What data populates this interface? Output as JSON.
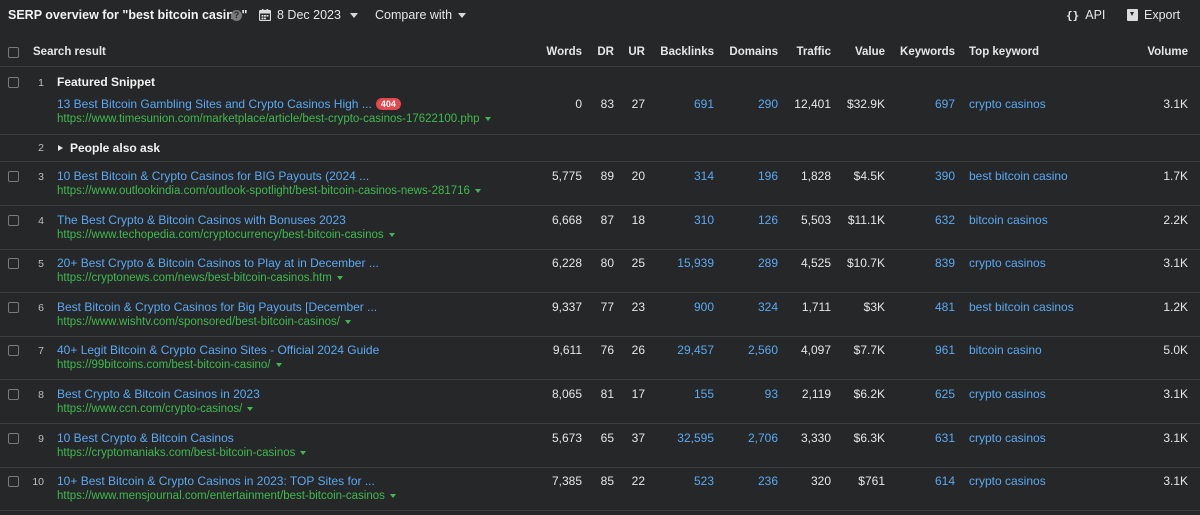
{
  "header": {
    "title": "SERP overview for \"best bitcoin casino\"",
    "help_icon": "?",
    "date": "8 Dec 2023",
    "compare_label": "Compare with",
    "api_icon": "{}",
    "api_label": "API",
    "export_label": "Export"
  },
  "columns": {
    "search_result": "Search result",
    "words": "Words",
    "dr": "DR",
    "ur": "UR",
    "backlinks": "Backlinks",
    "domains": "Domains",
    "traffic": "Traffic",
    "value": "Value",
    "keywords": "Keywords",
    "top_keyword": "Top keyword",
    "volume": "Volume"
  },
  "featured": {
    "pos": "1",
    "label": "Featured Snippet",
    "title": "13 Best Bitcoin Gambling Sites and Crypto Casinos High ...",
    "badge": "404",
    "url": "https://www.timesunion.com/marketplace/article/best-crypto-casinos-17622100.php",
    "words": "0",
    "dr": "83",
    "ur": "27",
    "backlinks": "691",
    "domains": "290",
    "traffic": "12,401",
    "value": "$32.9K",
    "keywords": "697",
    "top_keyword": "crypto casinos",
    "volume": "3.1K"
  },
  "people_also_ask": {
    "pos": "2",
    "label": "People also ask"
  },
  "rows": [
    {
      "pos": "3",
      "title": "10 Best Bitcoin & Crypto Casinos for BIG Payouts (2024 ...",
      "url": "https://www.outlookindia.com/outlook-spotlight/best-bitcoin-casinos-news-281716",
      "words": "5,775",
      "dr": "89",
      "ur": "20",
      "backlinks": "314",
      "domains": "196",
      "traffic": "1,828",
      "value": "$4.5K",
      "keywords": "390",
      "top_keyword": "best bitcoin casino",
      "volume": "1.7K"
    },
    {
      "pos": "4",
      "title": "The Best Crypto & Bitcoin Casinos with Bonuses 2023",
      "url": "https://www.techopedia.com/cryptocurrency/best-bitcoin-casinos",
      "words": "6,668",
      "dr": "87",
      "ur": "18",
      "backlinks": "310",
      "domains": "126",
      "traffic": "5,503",
      "value": "$11.1K",
      "keywords": "632",
      "top_keyword": "bitcoin casinos",
      "volume": "2.2K"
    },
    {
      "pos": "5",
      "title": "20+ Best Crypto & Bitcoin Casinos to Play at in December ...",
      "url": "https://cryptonews.com/news/best-bitcoin-casinos.htm",
      "words": "6,228",
      "dr": "80",
      "ur": "25",
      "backlinks": "15,939",
      "domains": "289",
      "traffic": "4,525",
      "value": "$10.7K",
      "keywords": "839",
      "top_keyword": "crypto casinos",
      "volume": "3.1K"
    },
    {
      "pos": "6",
      "title": "Best Bitcoin & Crypto Casinos for Big Payouts [December ...",
      "url": "https://www.wishtv.com/sponsored/best-bitcoin-casinos/",
      "words": "9,337",
      "dr": "77",
      "ur": "23",
      "backlinks": "900",
      "domains": "324",
      "traffic": "1,711",
      "value": "$3K",
      "keywords": "481",
      "top_keyword": "best bitcoin casinos",
      "volume": "1.2K"
    },
    {
      "pos": "7",
      "title": "40+ Legit Bitcoin & Crypto Casino Sites - Official 2024 Guide",
      "url": "https://99bitcoins.com/best-bitcoin-casino/",
      "words": "9,611",
      "dr": "76",
      "ur": "26",
      "backlinks": "29,457",
      "domains": "2,560",
      "traffic": "4,097",
      "value": "$7.7K",
      "keywords": "961",
      "top_keyword": "bitcoin casino",
      "volume": "5.0K"
    },
    {
      "pos": "8",
      "title": "Best Crypto & Bitcoin Casinos in 2023",
      "url": "https://www.ccn.com/crypto-casinos/",
      "words": "8,065",
      "dr": "81",
      "ur": "17",
      "backlinks": "155",
      "domains": "93",
      "traffic": "2,119",
      "value": "$6.2K",
      "keywords": "625",
      "top_keyword": "crypto casinos",
      "volume": "3.1K"
    },
    {
      "pos": "9",
      "title": "10 Best Crypto & Bitcoin Casinos",
      "url": "https://cryptomaniaks.com/best-bitcoin-casinos",
      "words": "5,673",
      "dr": "65",
      "ur": "37",
      "backlinks": "32,595",
      "domains": "2,706",
      "traffic": "3,330",
      "value": "$6.3K",
      "keywords": "631",
      "top_keyword": "crypto casinos",
      "volume": "3.1K"
    },
    {
      "pos": "10",
      "title": "10+ Best Bitcoin & Crypto Casinos in 2023: TOP Sites for ...",
      "url": "https://www.mensjournal.com/entertainment/best-bitcoin-casinos",
      "words": "7,385",
      "dr": "85",
      "ur": "22",
      "backlinks": "523",
      "domains": "236",
      "traffic": "320",
      "value": "$761",
      "keywords": "614",
      "top_keyword": "crypto casinos",
      "volume": "3.1K"
    }
  ]
}
